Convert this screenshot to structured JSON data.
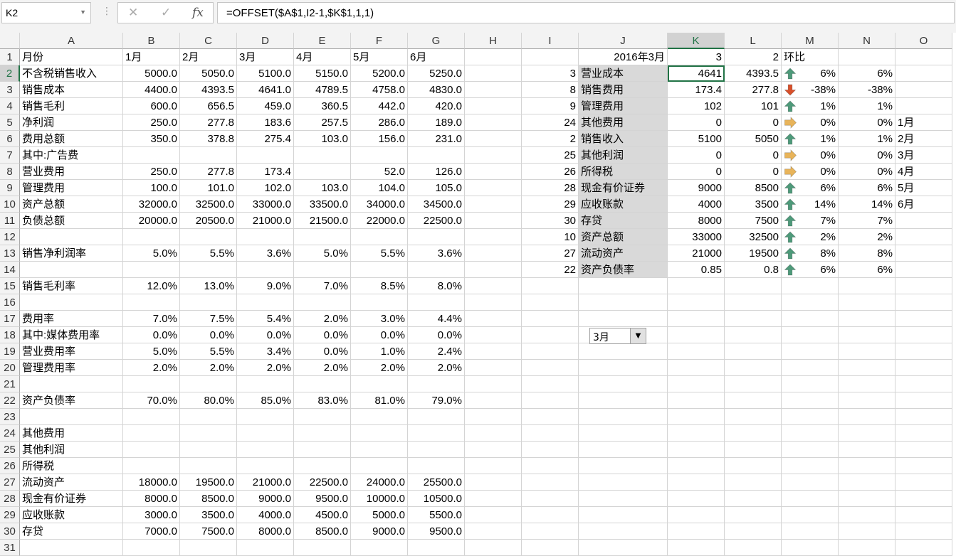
{
  "name_box": "K2",
  "formula": "=OFFSET($A$1,I2-1,$K$1,1,1)",
  "formula_buttons": {
    "cancel": "✕",
    "enter": "✓",
    "fx": "fx"
  },
  "columns": [
    "A",
    "B",
    "C",
    "D",
    "E",
    "F",
    "G",
    "H",
    "I",
    "J",
    "K",
    "L",
    "M",
    "N",
    "O"
  ],
  "selected_cell": {
    "col": "K",
    "row": "2"
  },
  "rows": [
    [
      "月份",
      "1月",
      "2月",
      "3月",
      "4月",
      "5月",
      "6月",
      "",
      "",
      "2016年3月",
      "3",
      "2",
      "环比",
      "",
      ""
    ],
    [
      "不含税销售收入",
      "5000.0",
      "5050.0",
      "5100.0",
      "5150.0",
      "5200.0",
      "5250.0",
      "",
      "3",
      "营业成本",
      "4641",
      "4393.5",
      "6%",
      "6%",
      ""
    ],
    [
      "销售成本",
      "4400.0",
      "4393.5",
      "4641.0",
      "4789.5",
      "4758.0",
      "4830.0",
      "",
      "8",
      "销售费用",
      "173.4",
      "277.8",
      "-38%",
      "-38%",
      ""
    ],
    [
      "销售毛利",
      "600.0",
      "656.5",
      "459.0",
      "360.5",
      "442.0",
      "420.0",
      "",
      "9",
      "管理费用",
      "102",
      "101",
      "1%",
      "1%",
      ""
    ],
    [
      "净利润",
      "250.0",
      "277.8",
      "183.6",
      "257.5",
      "286.0",
      "189.0",
      "",
      "24",
      "其他费用",
      "0",
      "0",
      "0%",
      "0%",
      "1月"
    ],
    [
      "费用总额",
      "350.0",
      "378.8",
      "275.4",
      "103.0",
      "156.0",
      "231.0",
      "",
      "2",
      "销售收入",
      "5100",
      "5050",
      "1%",
      "1%",
      "2月"
    ],
    [
      "其中:广告费",
      "",
      "",
      "",
      "",
      "",
      "",
      "",
      "25",
      "其他利润",
      "0",
      "0",
      "0%",
      "0%",
      "3月"
    ],
    [
      "营业费用",
      "250.0",
      "277.8",
      "173.4",
      "",
      "52.0",
      "126.0",
      "",
      "26",
      "所得税",
      "0",
      "0",
      "0%",
      "0%",
      "4月"
    ],
    [
      "管理费用",
      "100.0",
      "101.0",
      "102.0",
      "103.0",
      "104.0",
      "105.0",
      "",
      "28",
      "现金有价证券",
      "9000",
      "8500",
      "6%",
      "6%",
      "5月"
    ],
    [
      "资产总额",
      "32000.0",
      "32500.0",
      "33000.0",
      "33500.0",
      "34000.0",
      "34500.0",
      "",
      "29",
      "应收账款",
      "4000",
      "3500",
      "14%",
      "14%",
      "6月"
    ],
    [
      "负债总额",
      "20000.0",
      "20500.0",
      "21000.0",
      "21500.0",
      "22000.0",
      "22500.0",
      "",
      "30",
      "存贷",
      "8000",
      "7500",
      "7%",
      "7%",
      ""
    ],
    [
      "",
      "",
      "",
      "",
      "",
      "",
      "",
      "",
      "10",
      "资产总额",
      "33000",
      "32500",
      "2%",
      "2%",
      ""
    ],
    [
      "销售净利润率",
      "5.0%",
      "5.5%",
      "3.6%",
      "5.0%",
      "5.5%",
      "3.6%",
      "",
      "27",
      "流动资产",
      "21000",
      "19500",
      "8%",
      "8%",
      ""
    ],
    [
      "",
      "",
      "",
      "",
      "",
      "",
      "",
      "",
      "22",
      "资产负债率",
      "0.85",
      "0.8",
      "6%",
      "6%",
      ""
    ],
    [
      "销售毛利率",
      "12.0%",
      "13.0%",
      "9.0%",
      "7.0%",
      "8.5%",
      "8.0%",
      "",
      "",
      "",
      "",
      "",
      "",
      "",
      ""
    ],
    [
      "",
      "",
      "",
      "",
      "",
      "",
      "",
      "",
      "",
      "",
      "",
      "",
      "",
      "",
      ""
    ],
    [
      "费用率",
      "7.0%",
      "7.5%",
      "5.4%",
      "2.0%",
      "3.0%",
      "4.4%",
      "",
      "",
      "",
      "",
      "",
      "",
      "",
      ""
    ],
    [
      "其中:媒体费用率",
      "0.0%",
      "0.0%",
      "0.0%",
      "0.0%",
      "0.0%",
      "0.0%",
      "",
      "",
      "",
      "",
      "",
      "",
      "",
      ""
    ],
    [
      "营业费用率",
      "5.0%",
      "5.5%",
      "3.4%",
      "0.0%",
      "1.0%",
      "2.4%",
      "",
      "",
      "",
      "",
      "",
      "",
      "",
      ""
    ],
    [
      "管理费用率",
      "2.0%",
      "2.0%",
      "2.0%",
      "2.0%",
      "2.0%",
      "2.0%",
      "",
      "",
      "",
      "",
      "",
      "",
      "",
      ""
    ],
    [
      "",
      "",
      "",
      "",
      "",
      "",
      "",
      "",
      "",
      "",
      "",
      "",
      "",
      "",
      ""
    ],
    [
      "资产负债率",
      "70.0%",
      "80.0%",
      "85.0%",
      "83.0%",
      "81.0%",
      "79.0%",
      "",
      "",
      "",
      "",
      "",
      "",
      "",
      ""
    ],
    [
      "",
      "",
      "",
      "",
      "",
      "",
      "",
      "",
      "",
      "",
      "",
      "",
      "",
      "",
      ""
    ],
    [
      "其他费用",
      "",
      "",
      "",
      "",
      "",
      "",
      "",
      "",
      "",
      "",
      "",
      "",
      "",
      ""
    ],
    [
      "其他利润",
      "",
      "",
      "",
      "",
      "",
      "",
      "",
      "",
      "",
      "",
      "",
      "",
      "",
      ""
    ],
    [
      "所得税",
      "",
      "",
      "",
      "",
      "",
      "",
      "",
      "",
      "",
      "",
      "",
      "",
      "",
      ""
    ],
    [
      "流动资产",
      "18000.0",
      "19500.0",
      "21000.0",
      "22500.0",
      "24000.0",
      "25500.0",
      "",
      "",
      "",
      "",
      "",
      "",
      "",
      ""
    ],
    [
      "现金有价证券",
      "8000.0",
      "8500.0",
      "9000.0",
      "9500.0",
      "10000.0",
      "10500.0",
      "",
      "",
      "",
      "",
      "",
      "",
      "",
      ""
    ],
    [
      "应收账款",
      "3000.0",
      "3500.0",
      "4000.0",
      "4500.0",
      "5000.0",
      "5500.0",
      "",
      "",
      "",
      "",
      "",
      "",
      "",
      ""
    ],
    [
      "存贷",
      "7000.0",
      "7500.0",
      "8000.0",
      "8500.0",
      "9000.0",
      "9500.0",
      "",
      "",
      "",
      "",
      "",
      "",
      "",
      ""
    ],
    [
      "",
      "",
      "",
      "",
      "",
      "",
      "",
      "",
      "",
      "",
      "",
      "",
      "",
      "",
      ""
    ]
  ],
  "trend_icons": [
    "arrow-up",
    "arrow-down",
    "arrow-up",
    "arrow-right",
    "arrow-up",
    "arrow-right",
    "arrow-right",
    "arrow-up",
    "arrow-up",
    "arrow-up",
    "arrow-up",
    "arrow-up",
    "arrow-up"
  ],
  "icon_colors": {
    "arrow-up": "#4e9a7a",
    "arrow-down": "#d9502a",
    "arrow-right": "#e8b45a"
  },
  "month_dropdown": {
    "value": "3月"
  }
}
